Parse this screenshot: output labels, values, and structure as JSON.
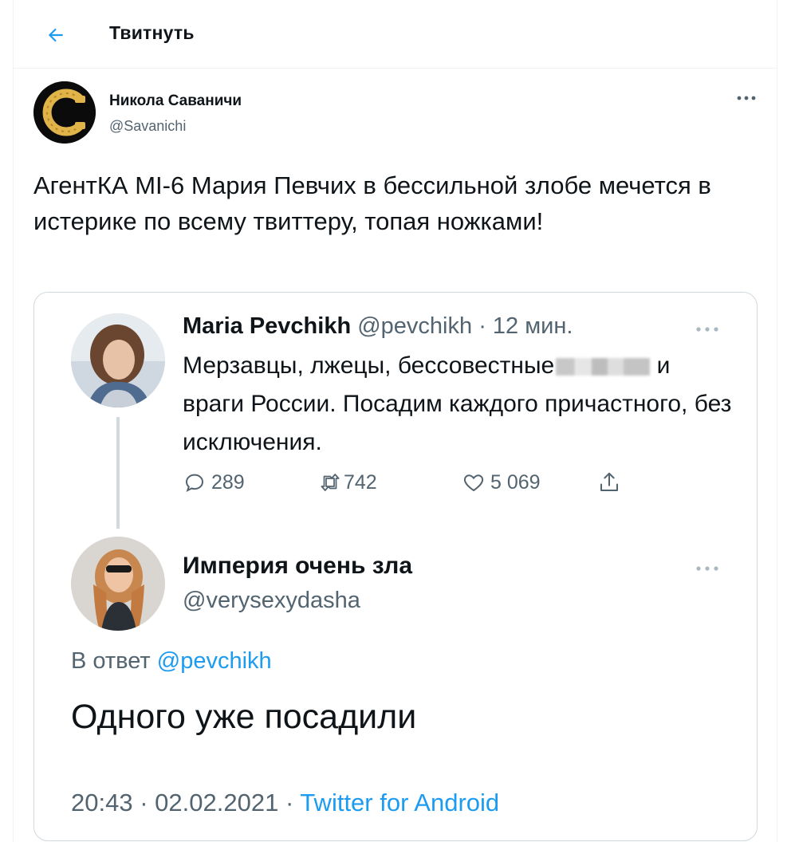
{
  "header": {
    "title": "Твитнуть"
  },
  "author": {
    "name": "Никола Саваничи",
    "handle": "@Savanichi"
  },
  "tweet": {
    "text": "АгентКА MI-6 Мария Певчих в бессильной злобе мечется в истерике по всему твиттеру, топая ножками!"
  },
  "quoted": {
    "tweet1": {
      "name": "Maria Pevchikh",
      "handle": "@pevchikh",
      "separator": "·",
      "time": "12 мин.",
      "text_before_blur": "Мерзавцы, лжецы, бессовестные",
      "text_after_blur": "и враги России. Посадим каждого причастного, без исключения.",
      "replies": "289",
      "retweets": "742",
      "likes": "5 069"
    },
    "tweet2": {
      "name": "Империя очень зла",
      "handle": "@verysexydasha",
      "reply_prefix": "В ответ",
      "reply_mention": "@pevchikh",
      "text": "Одного уже посадили",
      "time": "20:43",
      "separator": "·",
      "date": "02.02.2021",
      "separator2": "·",
      "source": "Twitter for Android"
    }
  },
  "colors": {
    "accent": "#1d9bf0",
    "muted": "#536471",
    "text": "#0f1419",
    "border": "#cfd9de"
  }
}
